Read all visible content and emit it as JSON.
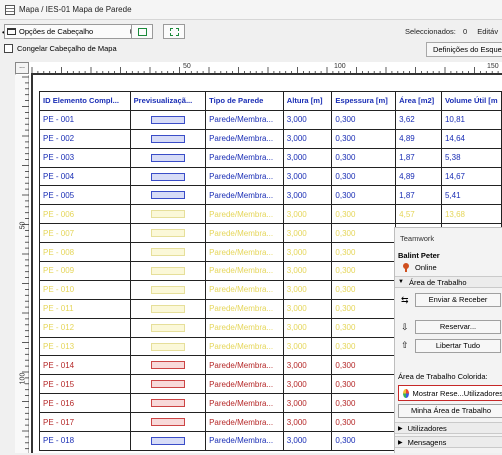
{
  "window": {
    "title": "Mapa / IES-01 Mapa de Parede"
  },
  "toolbar": {
    "header_options_label": "Opções de Cabeçalho",
    "selected_label": "Seleccionados:",
    "selected_count": "0",
    "editable_label": "Editáv",
    "freeze_header_label": "Congelar Cabeçalho de Mapa",
    "scheme_settings_label": "Definições do Esque"
  },
  "ruler": {
    "top_ticks": [
      "50",
      "100",
      "150"
    ],
    "left_ticks": [
      "50",
      "100"
    ]
  },
  "table": {
    "headers": [
      "ID Elemento Compl...",
      "Previsualizaçã...",
      "Tipo de Parede",
      "Altura [m]",
      "Espessura [m]",
      "Área [m2]",
      "Volume Útil [m"
    ],
    "rows": [
      {
        "id": "PE - 001",
        "type": "Parede/Membra...",
        "height": "3,000",
        "thickness": "0,300",
        "area": "3,62",
        "volume": "10,81",
        "color": "blue"
      },
      {
        "id": "PE - 002",
        "type": "Parede/Membra...",
        "height": "3,000",
        "thickness": "0,300",
        "area": "4,89",
        "volume": "14,64",
        "color": "blue"
      },
      {
        "id": "PE - 003",
        "type": "Parede/Membra...",
        "height": "3,000",
        "thickness": "0,300",
        "area": "1,87",
        "volume": "5,38",
        "color": "blue"
      },
      {
        "id": "PE - 004",
        "type": "Parede/Membra...",
        "height": "3,000",
        "thickness": "0,300",
        "area": "4,89",
        "volume": "14,67",
        "color": "blue"
      },
      {
        "id": "PE - 005",
        "type": "Parede/Membra...",
        "height": "3,000",
        "thickness": "0,300",
        "area": "1,87",
        "volume": "5,41",
        "color": "blue"
      },
      {
        "id": "PE - 006",
        "type": "Parede/Membra...",
        "height": "3,000",
        "thickness": "0,300",
        "area": "4,57",
        "volume": "13,68",
        "color": "yellow"
      },
      {
        "id": "PE - 007",
        "type": "Parede/Membra...",
        "height": "3,000",
        "thickness": "0,300",
        "area": "",
        "volume": "",
        "color": "yellow"
      },
      {
        "id": "PE - 008",
        "type": "Parede/Membra...",
        "height": "3,000",
        "thickness": "0,300",
        "area": "",
        "volume": "",
        "color": "yellow"
      },
      {
        "id": "PE - 009",
        "type": "Parede/Membra...",
        "height": "3,000",
        "thickness": "0,300",
        "area": "",
        "volume": "",
        "color": "yellow"
      },
      {
        "id": "PE - 010",
        "type": "Parede/Membra...",
        "height": "3,000",
        "thickness": "0,300",
        "area": "",
        "volume": "",
        "color": "yellow"
      },
      {
        "id": "PE - 011",
        "type": "Parede/Membra...",
        "height": "3,000",
        "thickness": "0,300",
        "area": "",
        "volume": "",
        "color": "yellow"
      },
      {
        "id": "PE - 012",
        "type": "Parede/Membra...",
        "height": "3,000",
        "thickness": "0,300",
        "area": "",
        "volume": "",
        "color": "yellow"
      },
      {
        "id": "PE - 013",
        "type": "Parede/Membra...",
        "height": "3,000",
        "thickness": "0,300",
        "area": "",
        "volume": "",
        "color": "yellow"
      },
      {
        "id": "PE - 014",
        "type": "Parede/Membra...",
        "height": "3,000",
        "thickness": "0,300",
        "area": "",
        "volume": "",
        "color": "red"
      },
      {
        "id": "PE - 015",
        "type": "Parede/Membra...",
        "height": "3,000",
        "thickness": "0,300",
        "area": "",
        "volume": "",
        "color": "red"
      },
      {
        "id": "PE - 016",
        "type": "Parede/Membra...",
        "height": "3,000",
        "thickness": "0,300",
        "area": "",
        "volume": "",
        "color": "red"
      },
      {
        "id": "PE - 017",
        "type": "Parede/Membra...",
        "height": "3,000",
        "thickness": "0,300",
        "area": "",
        "volume": "",
        "color": "red"
      },
      {
        "id": "PE - 018",
        "type": "Parede/Membra...",
        "height": "3,000",
        "thickness": "0,300",
        "area": "",
        "volume": "",
        "color": "blue"
      }
    ]
  },
  "teamwork": {
    "title": "Teamwork",
    "user": "Balint Peter",
    "status": "Online",
    "workspace_section": "Área de Trabalho",
    "send_receive": "Enviar & Receber",
    "reserve": "Reservar...",
    "release_all": "Libertar Tudo",
    "colored_workspace_label": "Área de Trabalho Colorida:",
    "show_reservations": "Mostrar Rese...Utilizadores",
    "my_workspace": "Minha Área de Trabalho",
    "users_section": "Utilizadores",
    "messages_section": "Mensagens"
  },
  "colors": {
    "blue_text": "#1a2eb5",
    "yellow_text": "#e5d65a",
    "red_text": "#b52828",
    "highlight_border": "#c62828"
  }
}
